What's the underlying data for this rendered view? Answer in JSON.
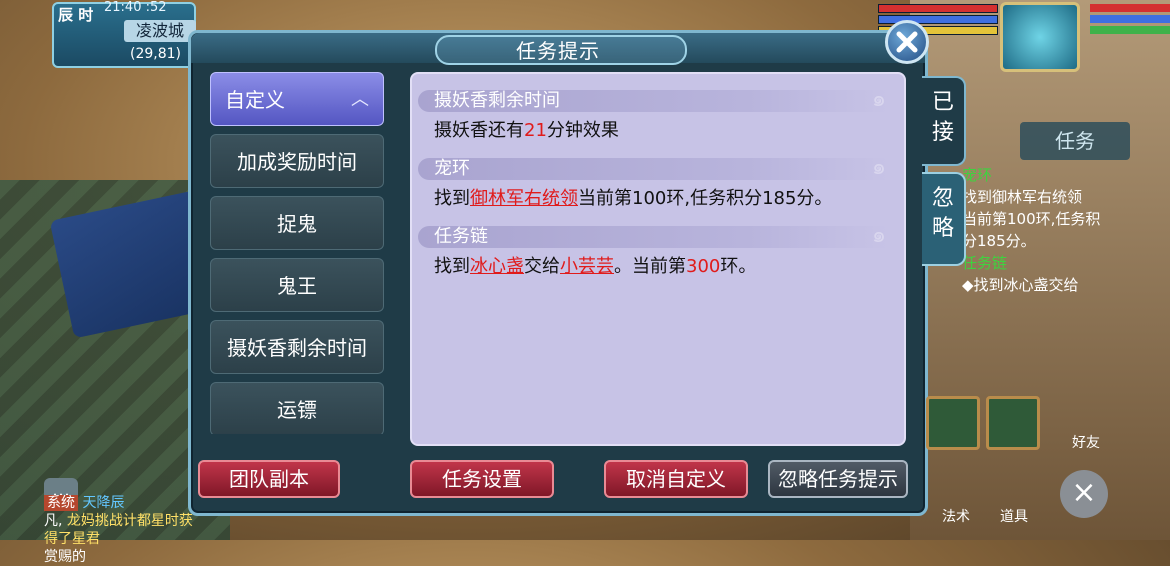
{
  "hud": {
    "time_label": "辰 时",
    "time": "21:40 :52",
    "city": "凌波城",
    "coords": "(29,81)"
  },
  "dialog": {
    "title": "任务提示",
    "categories": [
      {
        "label": "自定义",
        "selected": true
      },
      {
        "label": "加成奖励时间",
        "selected": false
      },
      {
        "label": "捉鬼",
        "selected": false
      },
      {
        "label": "鬼王",
        "selected": false
      },
      {
        "label": "摄妖香剩余时间",
        "selected": false
      },
      {
        "label": "运镖",
        "selected": false
      }
    ],
    "sections": [
      {
        "header": "摄妖香剩余时间",
        "line": {
          "a": "摄妖香还有",
          "num": "21",
          "b": "分钟效果"
        }
      },
      {
        "header": "宠环",
        "line": {
          "a": "找到",
          "link": "御林军右统领",
          "b": "当前第100环,任务积分185分。"
        }
      },
      {
        "header": "任务链",
        "line": {
          "a": "找到",
          "link1": "冰心盏",
          "b": "交给",
          "link2": "小芸芸",
          "c": "。当前第",
          "num": "300",
          "d": "环。"
        }
      }
    ],
    "buttons": {
      "team_dungeon": "团队副本",
      "task_settings": "任务设置",
      "cancel_custom": "取消自定义",
      "ignore_hints": "忽略任务提示"
    },
    "side_tabs": {
      "accepted": "已接",
      "ignored": "忽略"
    }
  },
  "right_panel": {
    "task_tab": "任务",
    "lines": [
      "宠环",
      "找到御林军右统领",
      "当前第100环,任务积",
      "分185分。",
      "任务链",
      "◆找到冰心盏交给"
    ]
  },
  "chat": {
    "tag": "系统",
    "text1": "天降辰",
    "text2": "凡,",
    "text3": "龙妈挑战计都星时获得了星君",
    "text4": "赏赐的"
  },
  "bottom_icons": {
    "friends": "好友",
    "magic": "法术",
    "items": "道具"
  },
  "colors": {
    "accent_red": "#e01b1b",
    "button_red": "#a1263a",
    "selected_purple": "#6f71d6",
    "content_bg": "#c7c3e6"
  }
}
